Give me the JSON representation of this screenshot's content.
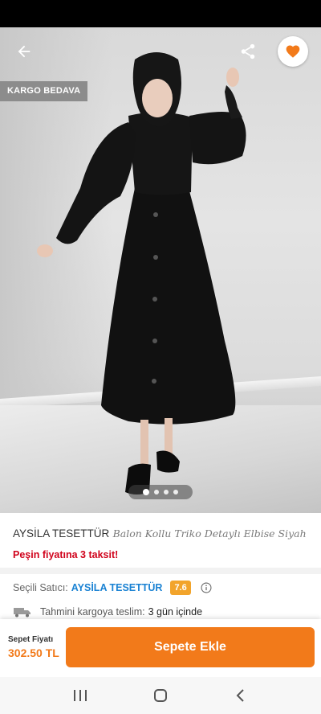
{
  "badges": {
    "cargo": "KARGO BEDAVA"
  },
  "gallery": {
    "dot_count": 4,
    "active_index": 0
  },
  "product": {
    "brand": "AYSİLA TESETTÜR",
    "name": "Balon Kollu Triko Detaylı Elbise Siyah",
    "installment": "Peşin fiyatına 3 taksit!"
  },
  "seller": {
    "prefix": "Seçili Satıcı:",
    "name": "AYSİLA TESETTÜR",
    "score": "7.6"
  },
  "delivery": {
    "label": "Tahmini kargoya teslim:",
    "value": "3 gün içinde"
  },
  "cart": {
    "price_label": "Sepet Fiyatı",
    "price": "302.50 TL",
    "button": "Sepete Ekle"
  },
  "colors": {
    "accent": "#f27a1a",
    "seller_link": "#1a82d3",
    "installment": "#d0021b",
    "score_bg": "#f2a42b"
  }
}
